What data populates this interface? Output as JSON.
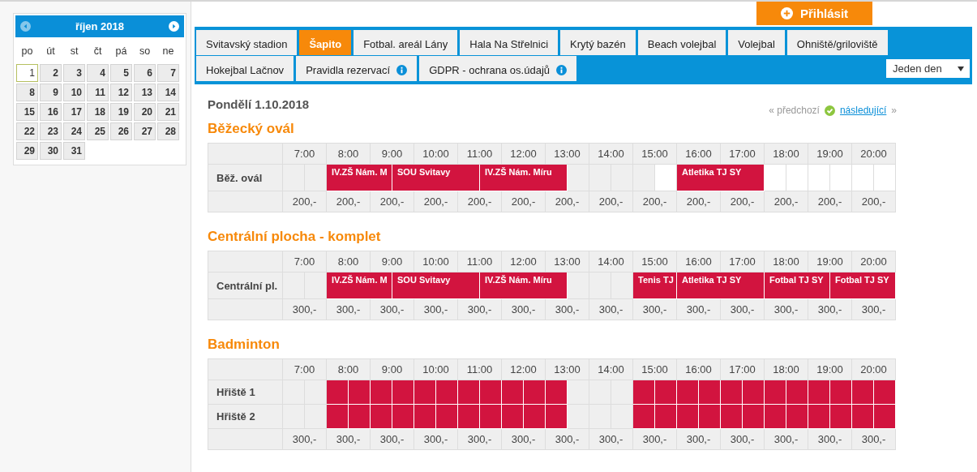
{
  "calendar": {
    "month": "říjen 2018",
    "prev_disabled": true,
    "weekdays": [
      "po",
      "út",
      "st",
      "čt",
      "pá",
      "so",
      "ne"
    ],
    "days": [
      {
        "day": "1",
        "selected": true
      },
      {
        "day": "2",
        "selected": false
      },
      {
        "day": "3",
        "selected": false
      },
      {
        "day": "4",
        "selected": false
      },
      {
        "day": "5",
        "selected": false
      },
      {
        "day": "6",
        "selected": false
      },
      {
        "day": "7",
        "selected": false
      },
      {
        "day": "8",
        "selected": false
      },
      {
        "day": "9",
        "selected": false
      },
      {
        "day": "10",
        "selected": false
      },
      {
        "day": "11",
        "selected": false
      },
      {
        "day": "12",
        "selected": false
      },
      {
        "day": "13",
        "selected": false
      },
      {
        "day": "14",
        "selected": false
      },
      {
        "day": "15",
        "selected": false
      },
      {
        "day": "16",
        "selected": false
      },
      {
        "day": "17",
        "selected": false
      },
      {
        "day": "18",
        "selected": false
      },
      {
        "day": "19",
        "selected": false
      },
      {
        "day": "20",
        "selected": false
      },
      {
        "day": "21",
        "selected": false
      },
      {
        "day": "22",
        "selected": false
      },
      {
        "day": "23",
        "selected": false
      },
      {
        "day": "24",
        "selected": false
      },
      {
        "day": "25",
        "selected": false
      },
      {
        "day": "26",
        "selected": false
      },
      {
        "day": "27",
        "selected": false
      },
      {
        "day": "28",
        "selected": false
      },
      {
        "day": "29",
        "selected": false
      },
      {
        "day": "30",
        "selected": false
      },
      {
        "day": "31",
        "selected": false
      }
    ]
  },
  "login_button": "Přihlásit",
  "tab_rows": [
    [
      {
        "label": "Svitavský stadion",
        "selected": false,
        "info": false
      },
      {
        "label": "Šapito",
        "selected": true,
        "info": false
      },
      {
        "label": "Fotbal. areál Lány",
        "selected": false,
        "info": false
      },
      {
        "label": "Hala Na Střelnici",
        "selected": false,
        "info": false
      },
      {
        "label": "Krytý bazén",
        "selected": false,
        "info": false
      },
      {
        "label": "Beach volejbal",
        "selected": false,
        "info": false
      },
      {
        "label": "Volejbal",
        "selected": false,
        "info": false
      },
      {
        "label": "Ohniště/griloviště",
        "selected": false,
        "info": false
      }
    ],
    [
      {
        "label": "Hokejbal Lačnov",
        "selected": false,
        "info": false
      },
      {
        "label": "Pravidla rezervací",
        "selected": false,
        "info": true
      },
      {
        "label": "GDPR - ochrana os.údajů",
        "selected": false,
        "info": true
      }
    ]
  ],
  "view_select": "Jeden den",
  "date": "Pondělí 1.10.2018",
  "nav": {
    "prev": "« předchozí",
    "next": "následující",
    "next_arrow": "»"
  },
  "sections": [
    {
      "title": "Běžecký ovál",
      "hours": [
        "7:00",
        "8:00",
        "9:00",
        "10:00",
        "11:00",
        "12:00",
        "13:00",
        "14:00",
        "15:00",
        "16:00",
        "17:00",
        "18:00",
        "19:00",
        "20:00"
      ],
      "rows": [
        {
          "name": "Běž. ovál",
          "slots": [
            {
              "kind": "past"
            },
            {
              "kind": "past"
            },
            {
              "kind": "booked",
              "label": "IV.ZŠ Nám. M"
            },
            {
              "kind": "continued"
            },
            {
              "kind": "continued"
            },
            {
              "kind": "booked",
              "label": "SOU Svitavy"
            },
            {
              "kind": "continued"
            },
            {
              "kind": "continued"
            },
            {
              "kind": "continued"
            },
            {
              "kind": "booked",
              "label": "IV.ZŠ Nám. Míru"
            },
            {
              "kind": "continued"
            },
            {
              "kind": "continued"
            },
            {
              "kind": "continued"
            },
            {
              "kind": "past"
            },
            {
              "kind": "past"
            },
            {
              "kind": "past"
            },
            {
              "kind": "past"
            },
            {
              "kind": "free"
            },
            {
              "kind": "booked",
              "label": "Atletika TJ SY"
            },
            {
              "kind": "continued"
            },
            {
              "kind": "continued"
            },
            {
              "kind": "continued"
            },
            {
              "kind": "free"
            },
            {
              "kind": "free"
            },
            {
              "kind": "free"
            },
            {
              "kind": "free"
            },
            {
              "kind": "free"
            },
            {
              "kind": "free"
            }
          ]
        }
      ],
      "prices": [
        "200,-",
        "200,-",
        "200,-",
        "200,-",
        "200,-",
        "200,-",
        "200,-",
        "200,-",
        "200,-",
        "200,-",
        "200,-",
        "200,-",
        "200,-",
        "200,-"
      ]
    },
    {
      "title": "Centrální plocha - komplet",
      "hours": [
        "7:00",
        "8:00",
        "9:00",
        "10:00",
        "11:00",
        "12:00",
        "13:00",
        "14:00",
        "15:00",
        "16:00",
        "17:00",
        "18:00",
        "19:00",
        "20:00"
      ],
      "rows": [
        {
          "name": "Centrální pl.",
          "slots": [
            {
              "kind": "past"
            },
            {
              "kind": "past"
            },
            {
              "kind": "booked",
              "label": "IV.ZŠ Nám. M"
            },
            {
              "kind": "continued"
            },
            {
              "kind": "continued"
            },
            {
              "kind": "booked",
              "label": "SOU Svitavy"
            },
            {
              "kind": "continued"
            },
            {
              "kind": "continued"
            },
            {
              "kind": "continued"
            },
            {
              "kind": "booked",
              "label": "IV.ZŠ Nám. Míru"
            },
            {
              "kind": "continued"
            },
            {
              "kind": "continued"
            },
            {
              "kind": "continued"
            },
            {
              "kind": "past"
            },
            {
              "kind": "past"
            },
            {
              "kind": "past"
            },
            {
              "kind": "booked",
              "label": "Tenis TJ"
            },
            {
              "kind": "continued"
            },
            {
              "kind": "booked",
              "label": "Atletika TJ SY"
            },
            {
              "kind": "continued"
            },
            {
              "kind": "continued"
            },
            {
              "kind": "continued"
            },
            {
              "kind": "booked",
              "label": "Fotbal TJ SY"
            },
            {
              "kind": "continued"
            },
            {
              "kind": "continued"
            },
            {
              "kind": "booked",
              "label": "Fotbal TJ SY"
            },
            {
              "kind": "continued"
            },
            {
              "kind": "continued"
            }
          ]
        }
      ],
      "prices": [
        "300,-",
        "300,-",
        "300,-",
        "300,-",
        "300,-",
        "300,-",
        "300,-",
        "300,-",
        "300,-",
        "300,-",
        "300,-",
        "300,-",
        "300,-",
        "300,-"
      ]
    },
    {
      "title": "Badminton",
      "hours": [
        "7:00",
        "8:00",
        "9:00",
        "10:00",
        "11:00",
        "12:00",
        "13:00",
        "14:00",
        "15:00",
        "16:00",
        "17:00",
        "18:00",
        "19:00",
        "20:00"
      ],
      "rows": [
        {
          "name": "Hřiště 1",
          "slots": [
            {
              "kind": "past"
            },
            {
              "kind": "past"
            },
            {
              "kind": "booked"
            },
            {
              "kind": "booked"
            },
            {
              "kind": "booked"
            },
            {
              "kind": "booked"
            },
            {
              "kind": "booked"
            },
            {
              "kind": "booked"
            },
            {
              "kind": "booked"
            },
            {
              "kind": "booked"
            },
            {
              "kind": "booked"
            },
            {
              "kind": "booked"
            },
            {
              "kind": "booked"
            },
            {
              "kind": "past"
            },
            {
              "kind": "past"
            },
            {
              "kind": "past"
            },
            {
              "kind": "booked"
            },
            {
              "kind": "booked"
            },
            {
              "kind": "booked"
            },
            {
              "kind": "booked"
            },
            {
              "kind": "booked"
            },
            {
              "kind": "booked"
            },
            {
              "kind": "booked"
            },
            {
              "kind": "booked"
            },
            {
              "kind": "booked"
            },
            {
              "kind": "booked"
            },
            {
              "kind": "booked"
            },
            {
              "kind": "booked"
            }
          ]
        },
        {
          "name": "Hřiště 2",
          "slots": [
            {
              "kind": "past"
            },
            {
              "kind": "past"
            },
            {
              "kind": "booked"
            },
            {
              "kind": "booked"
            },
            {
              "kind": "booked"
            },
            {
              "kind": "booked"
            },
            {
              "kind": "booked"
            },
            {
              "kind": "booked"
            },
            {
              "kind": "booked"
            },
            {
              "kind": "booked"
            },
            {
              "kind": "booked"
            },
            {
              "kind": "booked"
            },
            {
              "kind": "booked"
            },
            {
              "kind": "past"
            },
            {
              "kind": "past"
            },
            {
              "kind": "past"
            },
            {
              "kind": "booked"
            },
            {
              "kind": "booked"
            },
            {
              "kind": "booked"
            },
            {
              "kind": "booked"
            },
            {
              "kind": "booked"
            },
            {
              "kind": "booked"
            },
            {
              "kind": "booked"
            },
            {
              "kind": "booked"
            },
            {
              "kind": "booked"
            },
            {
              "kind": "booked"
            },
            {
              "kind": "booked"
            },
            {
              "kind": "booked"
            }
          ]
        }
      ],
      "prices": [
        "300,-",
        "300,-",
        "300,-",
        "300,-",
        "300,-",
        "300,-",
        "300,-",
        "300,-",
        "300,-",
        "300,-",
        "300,-",
        "300,-",
        "300,-",
        "300,-"
      ]
    }
  ]
}
